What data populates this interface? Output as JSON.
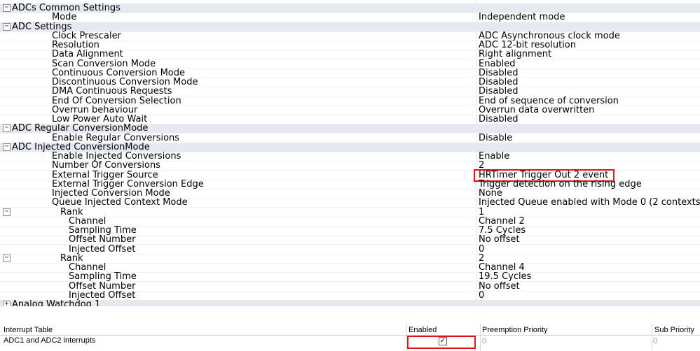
{
  "parameters": [
    {
      "kind": "category",
      "label": "ADCs Common Settings",
      "toggle": "−"
    },
    {
      "kind": "param",
      "level": 2,
      "label": "Mode",
      "value": "Independent mode"
    },
    {
      "kind": "category",
      "label": "ADC Settings",
      "toggle": "−"
    },
    {
      "kind": "param",
      "level": 2,
      "label": "Clock Prescaler",
      "value": "ADC Asynchronous clock mode"
    },
    {
      "kind": "param",
      "level": 2,
      "label": "Resolution",
      "value": "ADC 12-bit resolution"
    },
    {
      "kind": "param",
      "level": 2,
      "label": "Data Alignment",
      "value": "Right alignment"
    },
    {
      "kind": "param",
      "level": 2,
      "label": "Scan Conversion Mode",
      "value": "Enabled"
    },
    {
      "kind": "param",
      "level": 2,
      "label": "Continuous Conversion Mode",
      "value": "Disabled"
    },
    {
      "kind": "param",
      "level": 2,
      "label": "Discontinuous Conversion Mode",
      "value": "Disabled"
    },
    {
      "kind": "param",
      "level": 2,
      "label": "DMA Continuous Requests",
      "value": "Disabled"
    },
    {
      "kind": "param",
      "level": 2,
      "label": "End Of Conversion Selection",
      "value": "End of sequence of conversion"
    },
    {
      "kind": "param",
      "level": 2,
      "label": "Overrun behaviour",
      "value": "Overrun data overwritten"
    },
    {
      "kind": "param",
      "level": 2,
      "label": "Low Power Auto Wait",
      "value": "Disabled"
    },
    {
      "kind": "category",
      "label": "ADC Regular ConversionMode",
      "toggle": "−"
    },
    {
      "kind": "param",
      "level": 2,
      "label": "Enable Regular Conversions",
      "value": "Disable"
    },
    {
      "kind": "category",
      "label": "ADC Injected ConversionMode",
      "toggle": "−"
    },
    {
      "kind": "param",
      "level": 2,
      "label": "Enable Injected Conversions",
      "value": "Enable"
    },
    {
      "kind": "param",
      "level": 2,
      "label": "Number Of Conversions",
      "value": "2"
    },
    {
      "kind": "param",
      "level": 2,
      "label": "External Trigger Source",
      "value": "HRTimer Trigger Out 2 event",
      "highlight": true
    },
    {
      "kind": "param",
      "level": 2,
      "label": "External Trigger Conversion Edge",
      "value": "Trigger detection on the rising edge"
    },
    {
      "kind": "param",
      "level": 2,
      "label": "Injected Conversion Mode",
      "value": "None"
    },
    {
      "kind": "param",
      "level": 2,
      "label": "Queue Injected Context Mode",
      "value": "Injected Queue enabled with Mode 0 (2 contexts"
    },
    {
      "kind": "group",
      "level": 3,
      "label": "Rank",
      "value": "1",
      "toggle": "−"
    },
    {
      "kind": "param",
      "level": 4,
      "label": "Channel",
      "value": "Channel 2"
    },
    {
      "kind": "param",
      "level": 4,
      "label": "Sampling Time",
      "value": "7.5 Cycles"
    },
    {
      "kind": "param",
      "level": 4,
      "label": "Offset Number",
      "value": "No offset"
    },
    {
      "kind": "param",
      "level": 4,
      "label": "Injected Offset",
      "value": "0"
    },
    {
      "kind": "group",
      "level": 3,
      "label": "Rank",
      "value": "2",
      "toggle": "−"
    },
    {
      "kind": "param",
      "level": 4,
      "label": "Channel",
      "value": "Channel 4"
    },
    {
      "kind": "param",
      "level": 4,
      "label": "Sampling Time",
      "value": "19.5 Cycles"
    },
    {
      "kind": "param",
      "level": 4,
      "label": "Offset Number",
      "value": "No offset"
    },
    {
      "kind": "param",
      "level": 4,
      "label": "Injected Offset",
      "value": "0"
    },
    {
      "kind": "category",
      "label": "Analog Watchdog 1",
      "toggle": "+"
    }
  ],
  "interrupt_table": {
    "headers": {
      "name": "Interrupt Table",
      "enabled": "Enabled",
      "preemption": "Preemption Priority",
      "sub": "Sub Priority"
    },
    "row": {
      "name": "ADC1 and ADC2 interrupts",
      "enabled_mark": "✓",
      "enabled": true,
      "preemption": "0",
      "sub": "0"
    }
  },
  "colors": {
    "category_bg": "#e6e9ef",
    "highlight_box": "#e0141b"
  }
}
